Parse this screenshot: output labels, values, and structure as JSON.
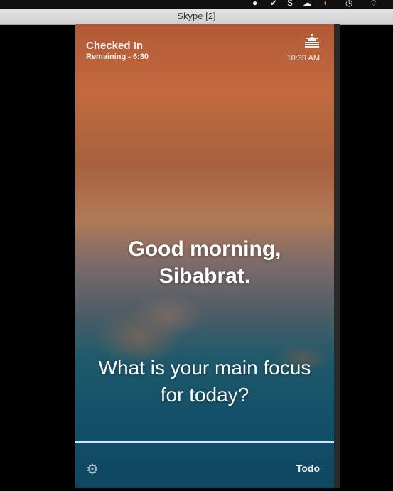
{
  "window": {
    "title": "Skype [2]"
  },
  "menubar": {
    "icons": [
      "chat-icon",
      "check-icon",
      "skype-icon",
      "cloud-icon",
      "app-icon",
      "time-machine-icon",
      "wifi-icon"
    ]
  },
  "app": {
    "status": "Checked In",
    "remaining": "Remaining - 6:30",
    "weather_icon": "sunrise-icon",
    "time": "10:39 AM",
    "greeting": "Good morning, Sibabrat.",
    "greeting_line1": "Good morning,",
    "greeting_line2": "Sibabrat.",
    "focus_prompt_line1": "What is your main focus",
    "focus_prompt_line2": "for today?",
    "todo_label": "Todo"
  }
}
